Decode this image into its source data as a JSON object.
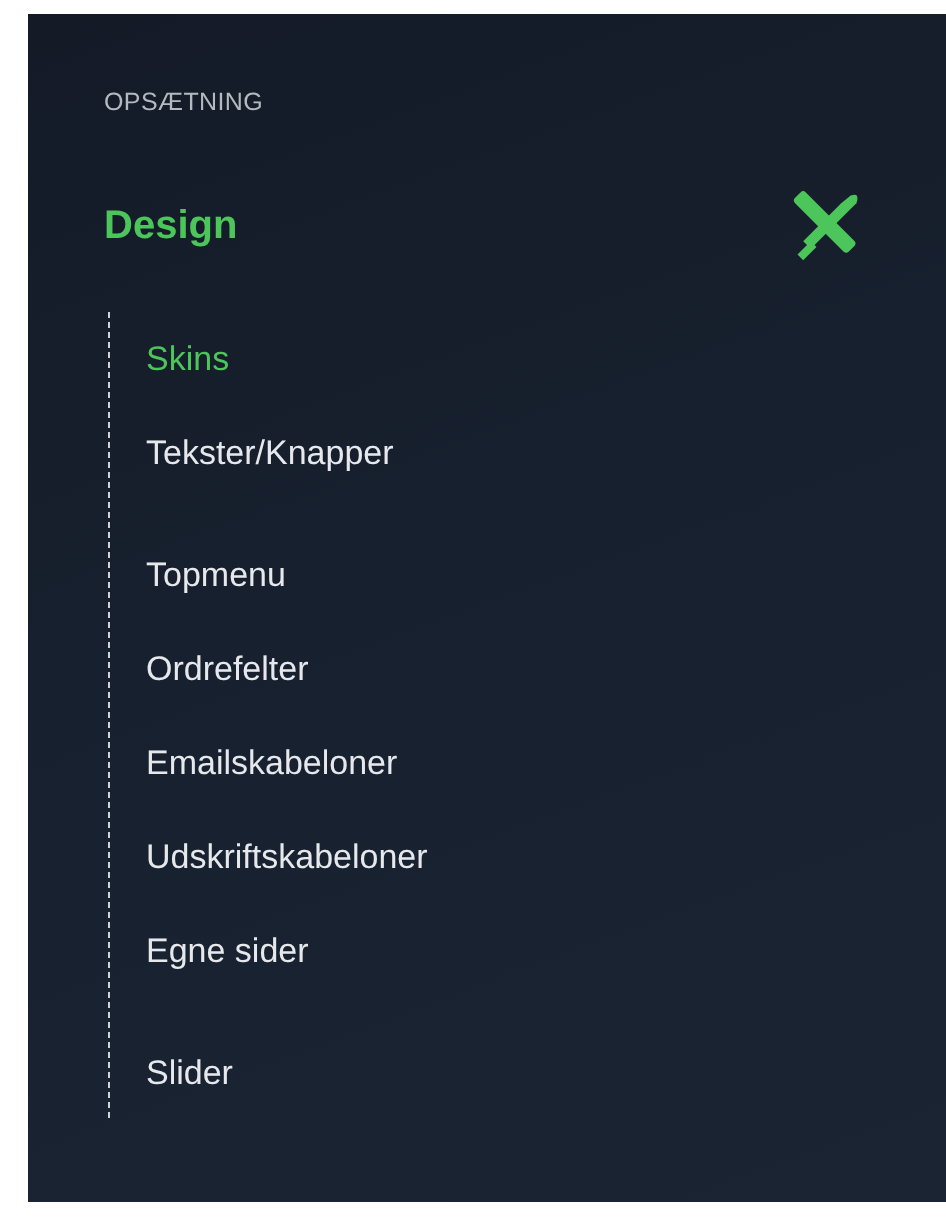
{
  "section_heading": "OPSÆTNING",
  "group": {
    "label": "Design"
  },
  "items": [
    {
      "label": "Skins",
      "selected": true
    },
    {
      "label": "Tekster/Knapper",
      "selected": false
    },
    {
      "label": "Topmenu",
      "selected": false
    },
    {
      "label": "Ordrefelter",
      "selected": false
    },
    {
      "label": "Emailskabeloner",
      "selected": false
    },
    {
      "label": "Udskriftskabeloner",
      "selected": false
    },
    {
      "label": "Egne sider",
      "selected": false
    },
    {
      "label": "Slider",
      "selected": false
    }
  ]
}
